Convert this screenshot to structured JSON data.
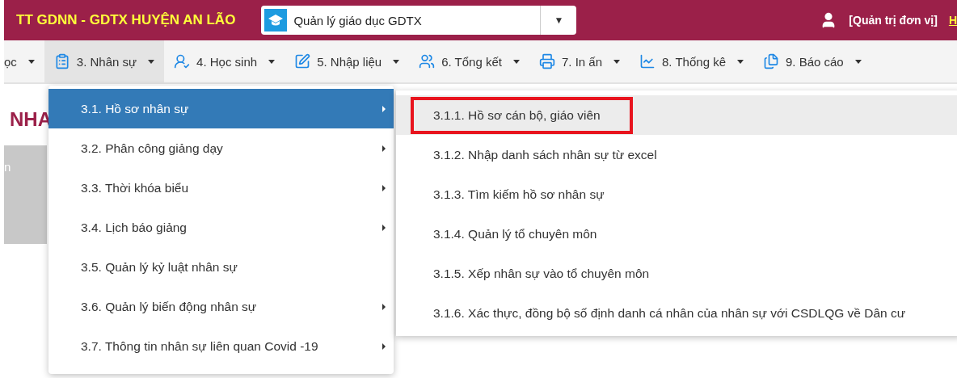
{
  "header": {
    "title": "TT GDNN - GDTX HUYỆN AN LÃO",
    "module_select": {
      "value": "Quản lý giáo dục GDTX",
      "arrow": "▼"
    },
    "user": "[Quản trị đơn vị]",
    "link": "H"
  },
  "nav": [
    {
      "label": "ọc",
      "selected": false
    },
    {
      "label": "3. Nhân sự",
      "selected": true
    },
    {
      "label": "4. Học sinh",
      "selected": false
    },
    {
      "label": "5. Nhập liệu",
      "selected": false
    },
    {
      "label": "6. Tổng kết",
      "selected": false
    },
    {
      "label": "7. In ấn",
      "selected": false
    },
    {
      "label": "8. Thống kê",
      "selected": false
    },
    {
      "label": "9. Báo cáo",
      "selected": false
    }
  ],
  "page": {
    "heading": "NHA",
    "panel_text": "n"
  },
  "menu": [
    {
      "label": "3.1. Hồ sơ nhân sự",
      "selected": true,
      "has_submenu": true
    },
    {
      "label": "3.2. Phân công giảng dạy",
      "selected": false,
      "has_submenu": true
    },
    {
      "label": "3.3. Thời khóa biểu",
      "selected": false,
      "has_submenu": true
    },
    {
      "label": "3.4. Lịch báo giảng",
      "selected": false,
      "has_submenu": true
    },
    {
      "label": "3.5. Quản lý kỷ luật nhân sự",
      "selected": false,
      "has_submenu": false
    },
    {
      "label": "3.6. Quản lý biến động nhân sự",
      "selected": false,
      "has_submenu": true
    },
    {
      "label": "3.7. Thông tin nhân sự liên quan Covid -19",
      "selected": false,
      "has_submenu": true
    }
  ],
  "submenu": [
    {
      "label": "3.1.1. Hồ sơ cán bộ, giáo viên",
      "selected": true,
      "outlined": true
    },
    {
      "label": "3.1.2. Nhập danh sách nhân sự từ excel",
      "selected": false,
      "outlined": false
    },
    {
      "label": "3.1.3. Tìm kiếm hồ sơ nhân sự",
      "selected": false,
      "outlined": false
    },
    {
      "label": "3.1.4. Quản lý tổ chuyên môn",
      "selected": false,
      "outlined": false
    },
    {
      "label": "3.1.5. Xếp nhân sự vào tổ chuyên môn",
      "selected": false,
      "outlined": false
    },
    {
      "label": "3.1.6. Xác thực, đồng bộ số định danh cá nhân của nhân sự với CSDLQG về Dân cư",
      "selected": false,
      "outlined": false
    }
  ]
}
